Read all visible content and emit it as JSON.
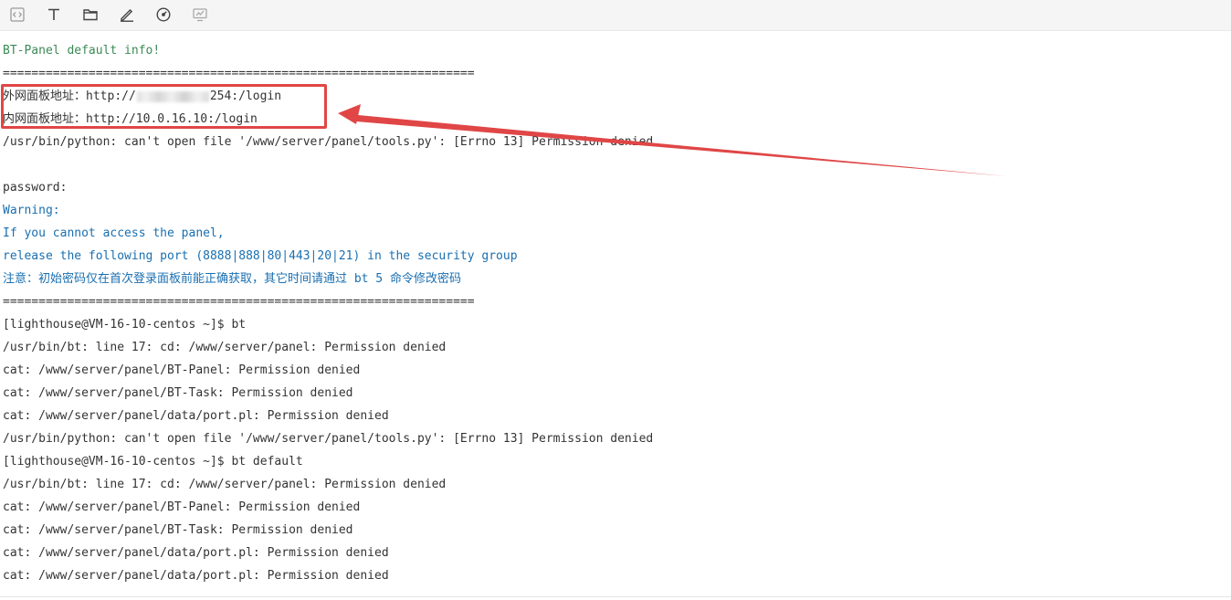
{
  "toolbar": {
    "icons": [
      "code-icon",
      "text-format-icon",
      "folder-icon",
      "edit-pencil-icon",
      "dashboard-gauge-icon",
      "monitor-chart-icon"
    ]
  },
  "terminal": {
    "header": "BT-Panel default info!",
    "separator1": "==================================================================",
    "external_label": "外网面板地址：",
    "external_url_prefix": "http://",
    "external_url_suffix": "254:/login",
    "internal_label": "内网面板地址：",
    "internal_url": "http://10.0.16.10:/login",
    "python_error1": "/usr/bin/python: can't open file '/www/server/panel/tools.py': [Errno 13] Permission denied",
    "password": "password:",
    "warning": "Warning:",
    "if_cannot": "If you cannot access the panel,",
    "release_ports": "release the following port (8888|888|80|443|20|21) in the security group",
    "note": "注意：初始密码仅在首次登录面板前能正确获取，其它时间请通过 bt 5 命令修改密码",
    "separator2": "==================================================================",
    "prompt1": "[lighthouse@VM-16-10-centos ~]$ bt",
    "err_cd1": "/usr/bin/bt: line 17: cd: /www/server/panel: Permission denied",
    "err_cat_panel1": "cat: /www/server/panel/BT-Panel: Permission denied",
    "err_cat_task1": "cat: /www/server/panel/BT-Task: Permission denied",
    "err_cat_port1": "cat: /www/server/panel/data/port.pl: Permission denied",
    "python_error2": "/usr/bin/python: can't open file '/www/server/panel/tools.py': [Errno 13] Permission denied",
    "prompt2": "[lighthouse@VM-16-10-centos ~]$ bt default",
    "err_cd2": "/usr/bin/bt: line 17: cd: /www/server/panel: Permission denied",
    "err_cat_panel2": "cat: /www/server/panel/BT-Panel: Permission denied",
    "err_cat_task2": "cat: /www/server/panel/BT-Task: Permission denied",
    "err_cat_port2": "cat: /www/server/panel/data/port.pl: Permission denied",
    "err_cat_port3": "cat: /www/server/panel/data/port.pl: Permission denied"
  },
  "colors": {
    "annotation": "#e04646",
    "header_text": "#3a8a56",
    "warning_text": "#1a6fb0",
    "body_text": "#333333"
  }
}
